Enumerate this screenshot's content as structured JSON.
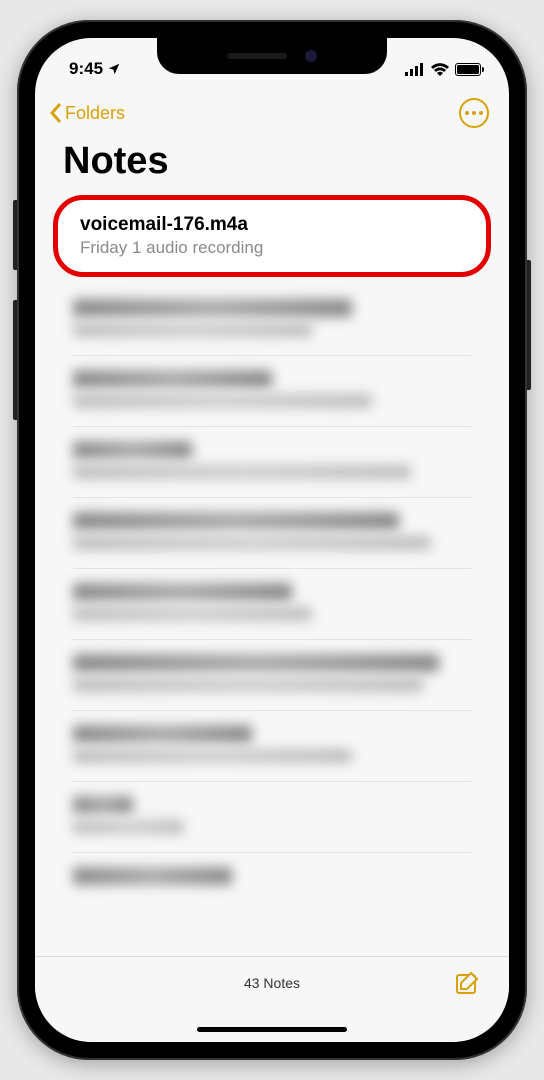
{
  "status": {
    "time": "9:45"
  },
  "nav": {
    "back_label": "Folders"
  },
  "page": {
    "title": "Notes"
  },
  "first_note": {
    "title": "voicemail-176.m4a",
    "subtitle": "Friday  1 audio recording"
  },
  "toolbar": {
    "count_label": "43 Notes"
  }
}
